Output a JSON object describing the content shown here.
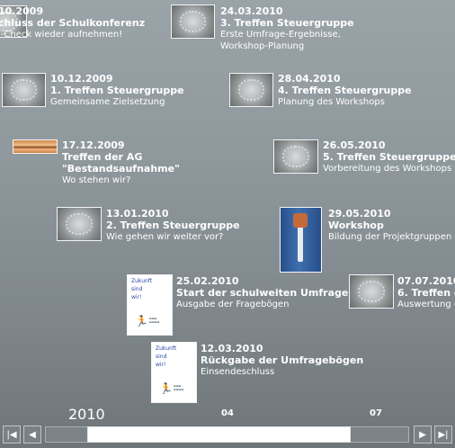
{
  "events": [
    {
      "date": "10.2009",
      "title": "chluss der Schulkonferenz",
      "desc": "l-Check wieder aufnehmen!"
    },
    {
      "date": "24.03.2010",
      "title": "3. Treffen Steuergruppe",
      "desc": "Erste Umfrage-Ergebnisse,",
      "desc2": "Workshop-Planung"
    },
    {
      "date": "10.12.2009",
      "title": "1. Treffen Steuergruppe",
      "desc": "Gemeinsame Zielsetzung"
    },
    {
      "date": "28.04.2010",
      "title": "4. Treffen Steuergruppe",
      "desc": "Planung des Workshops"
    },
    {
      "date": "17.12.2009",
      "title": "Treffen der AG",
      "title2": "\"Bestandsaufnahme\"",
      "desc": "Wo stehen wir?"
    },
    {
      "date": "26.05.2010",
      "title": "5. Treffen Steuergruppe",
      "desc": "Vorbereitung des Workshops"
    },
    {
      "date": "13.01.2010",
      "title": "2. Treffen Steuergruppe",
      "desc": "Wie gehen wir weiter vor?"
    },
    {
      "date": "29.05.2010",
      "title": "Workshop",
      "desc": "Bildung der Projektgruppen"
    },
    {
      "date": "25.02.2010",
      "title": "Start der schulweiten Umfrage",
      "desc": "Ausgabe der Fragebögen"
    },
    {
      "date": "07.07.2010",
      "title": "6. Treffen d",
      "desc": "Auswertung d"
    },
    {
      "date": "12.03.2010",
      "title": "Rückgabe der Umfragebögen",
      "desc": "Einsendeschluss"
    }
  ],
  "paper": {
    "line1": "Zukunft",
    "line2": "sind",
    "line3": "wir!"
  },
  "timeline": {
    "year": "2010",
    "tick_04": "04",
    "tick_07": "07"
  },
  "controls": {
    "first": "first-icon",
    "prev": "prev-icon",
    "next": "next-icon",
    "last": "last-icon"
  }
}
